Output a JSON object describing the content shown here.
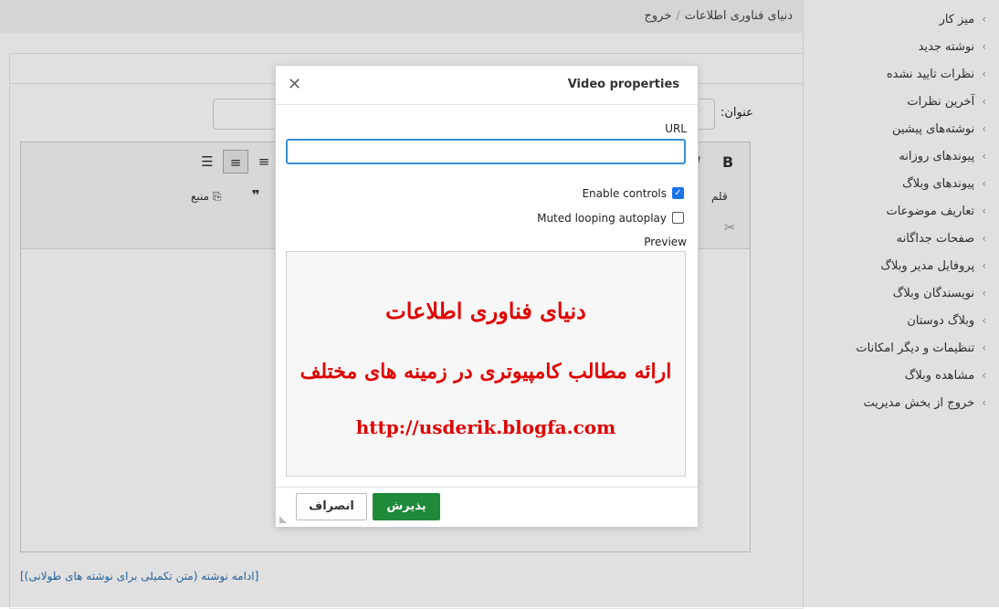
{
  "breadcrumb": {
    "home": "دنیای فناوری اطلاعات",
    "separator": "/",
    "current": "خروج"
  },
  "sidebar": {
    "items": [
      {
        "label": "میز کار"
      },
      {
        "label": "نوشته جدید"
      },
      {
        "label": "نظرات تایید نشده"
      },
      {
        "label": "آخرین نظرات"
      },
      {
        "label": "نوشته‌های پیشین"
      },
      {
        "label": "پیوندهای روزانه"
      },
      {
        "label": "پیوندهای وبلاگ"
      },
      {
        "label": "تعاریف موضوعات"
      },
      {
        "label": "صفحات جداگانه"
      },
      {
        "label": "پروفایل مدیر وبلاگ"
      },
      {
        "label": "نویسندگان وبلاگ"
      },
      {
        "label": "وبلاگ دوستان"
      },
      {
        "label": "تنظیمات و دیگر امکانات"
      },
      {
        "label": "مشاهده وبلاگ"
      },
      {
        "label": "خروج از بخش مدیریت"
      }
    ]
  },
  "form": {
    "title_label": "عنوان:",
    "font_label": "قلم",
    "source_label": "منبع",
    "more_link": "[ادامه نوشته (متن تکمیلی برای نوشته های طولانی)]"
  },
  "dialog": {
    "title": "Video properties",
    "url_label": "URL",
    "url_value": "",
    "enable_controls_label": "Enable controls",
    "enable_controls_checked": true,
    "muted_autoplay_label": "Muted looping autoplay",
    "muted_autoplay_checked": false,
    "preview_label": "Preview",
    "preview_line1": "دنیای فناوری اطلاعات",
    "preview_line2": "ارائه مطالب کامپیوتری در زمینه های مختلف",
    "preview_line3": "http://usderik.blogfa.com",
    "ok_label": "پذیرش",
    "cancel_label": "انصراف"
  },
  "colors": {
    "accent": "#3a8fd6",
    "ok_button": "#1e8a3a",
    "preview_text": "#e00000"
  }
}
